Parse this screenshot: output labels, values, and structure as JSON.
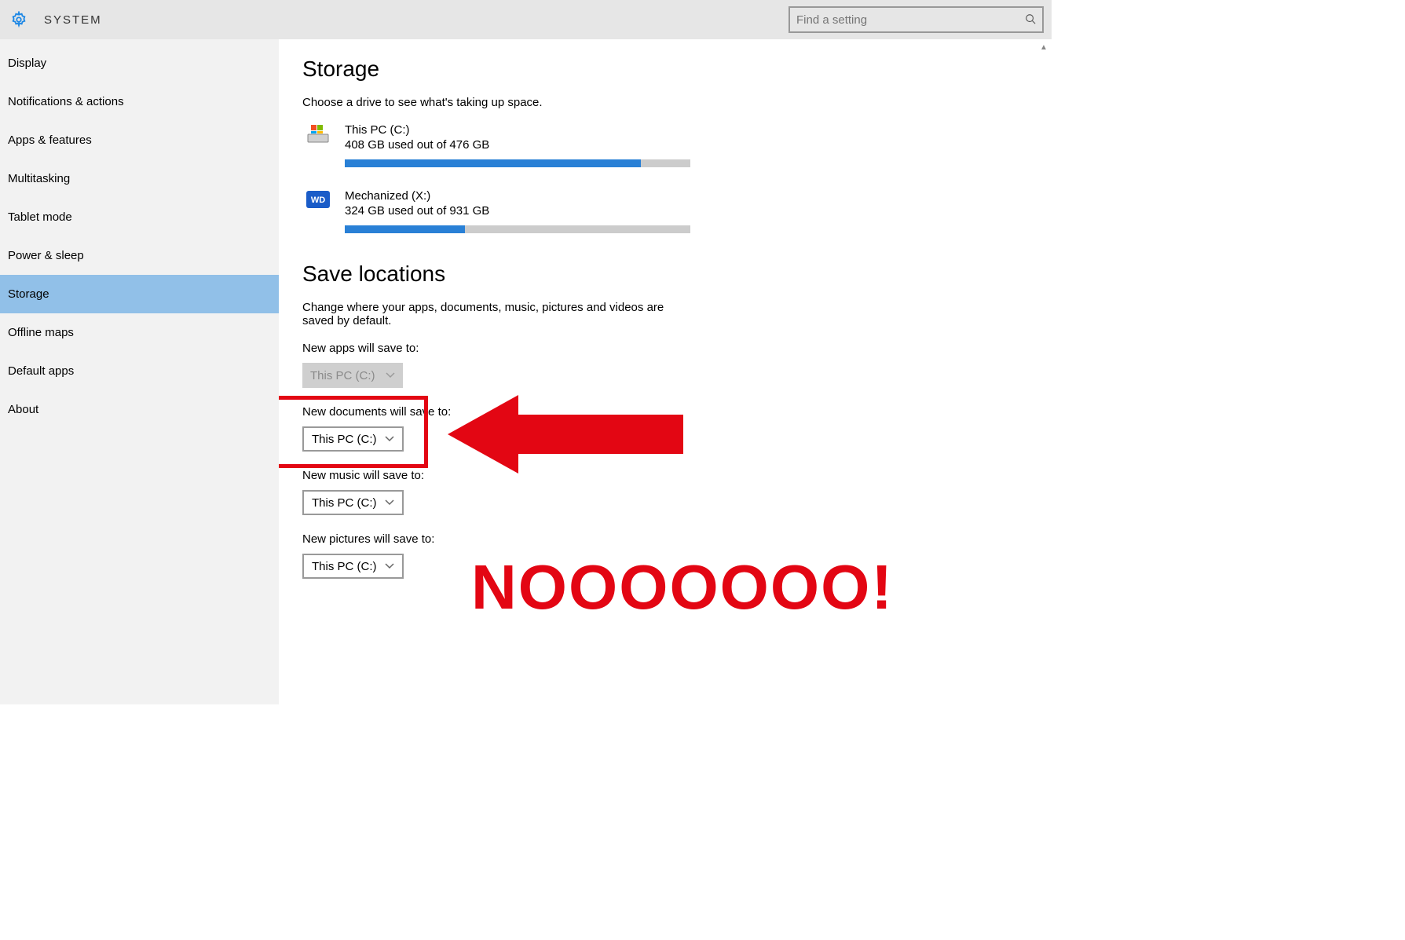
{
  "header": {
    "title": "SYSTEM",
    "search_placeholder": "Find a setting"
  },
  "sidebar": {
    "items": [
      {
        "label": "Display",
        "selected": false
      },
      {
        "label": "Notifications & actions",
        "selected": false
      },
      {
        "label": "Apps & features",
        "selected": false
      },
      {
        "label": "Multitasking",
        "selected": false
      },
      {
        "label": "Tablet mode",
        "selected": false
      },
      {
        "label": "Power & sleep",
        "selected": false
      },
      {
        "label": "Storage",
        "selected": true
      },
      {
        "label": "Offline maps",
        "selected": false
      },
      {
        "label": "Default apps",
        "selected": false
      },
      {
        "label": "About",
        "selected": false
      }
    ]
  },
  "storage": {
    "heading": "Storage",
    "subtext": "Choose a drive to see what's taking up space.",
    "drives": [
      {
        "name": "This PC (C:)",
        "usage_text": "408 GB used out of 476 GB",
        "used": 408,
        "total": 476,
        "icon": "windows"
      },
      {
        "name": "Mechanized (X:)",
        "usage_text": "324 GB used out of 931 GB",
        "used": 324,
        "total": 931,
        "icon": "wd"
      }
    ]
  },
  "save_locations": {
    "heading": "Save locations",
    "subtext": "Change where your apps, documents, music, pictures and videos are saved by default.",
    "settings": [
      {
        "label": "New apps will save to:",
        "value": "This PC (C:)",
        "disabled": true
      },
      {
        "label": "New documents will save to:",
        "value": "This PC (C:)",
        "disabled": false
      },
      {
        "label": "New music will save to:",
        "value": "This PC (C:)",
        "disabled": false
      },
      {
        "label": "New pictures will save to:",
        "value": "This PC (C:)",
        "disabled": false
      }
    ]
  },
  "annotation": {
    "text": "NOOOOOOO!"
  }
}
